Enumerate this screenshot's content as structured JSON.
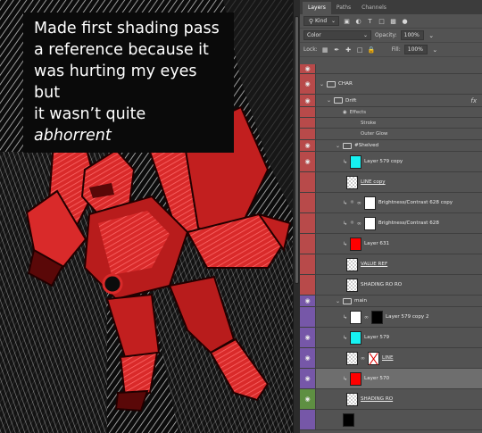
{
  "caption": {
    "line1": "Made first shading pass",
    "line2": "a reference because it",
    "line3": "was hurting my eyes but",
    "line4_prefix": "it wasn’t quite ",
    "line4_emph": "abhorrent"
  },
  "colors": {
    "canvas_bg": "#0c0c0c",
    "robot_red": "#d92a2a",
    "robot_dark": "#5a0808",
    "panel_bg": "#535353",
    "eye_red": "#b84a4a",
    "eye_purple": "#7657a8",
    "eye_green": "#5e8f42",
    "thumb_cyan": "#16f2f2",
    "thumb_red": "#ff0000"
  },
  "panel": {
    "tabs": [
      "Layers",
      "Paths",
      "Channels"
    ],
    "filter_kind": "Kind",
    "blend_mode": "Color",
    "opacity_label": "Opacity:",
    "opacity_value": "100%",
    "lock_label": "Lock:",
    "fill_label": "Fill:",
    "fill_value": "100%"
  },
  "layers": [
    {
      "name": "CHAR",
      "type": "group"
    },
    {
      "name": "Drift",
      "type": "group",
      "fx": "fx"
    },
    {
      "name": "Effects",
      "type": "effect-header"
    },
    {
      "name": "Stroke",
      "type": "effect"
    },
    {
      "name": "Outer Glow",
      "type": "effect"
    },
    {
      "name": "#Shelved",
      "type": "group"
    },
    {
      "name": "Layer 579 copy",
      "type": "layer"
    },
    {
      "name": "LINE copy",
      "type": "layer"
    },
    {
      "name": "Brightness/Contrast 628 copy",
      "type": "adjustment"
    },
    {
      "name": "Brightness/Contrast 628",
      "type": "adjustment"
    },
    {
      "name": "Layer 631",
      "type": "layer"
    },
    {
      "name": "VALUE REF",
      "type": "layer"
    },
    {
      "name": "SHADING RO RO",
      "type": "layer"
    },
    {
      "name": "main",
      "type": "group"
    },
    {
      "name": "Layer 579 copy 2",
      "type": "layer"
    },
    {
      "name": "Layer 579",
      "type": "layer"
    },
    {
      "name": "LINE",
      "type": "layer"
    },
    {
      "name": "Layer 570",
      "type": "layer"
    },
    {
      "name": "SHADING RO",
      "type": "layer"
    }
  ]
}
